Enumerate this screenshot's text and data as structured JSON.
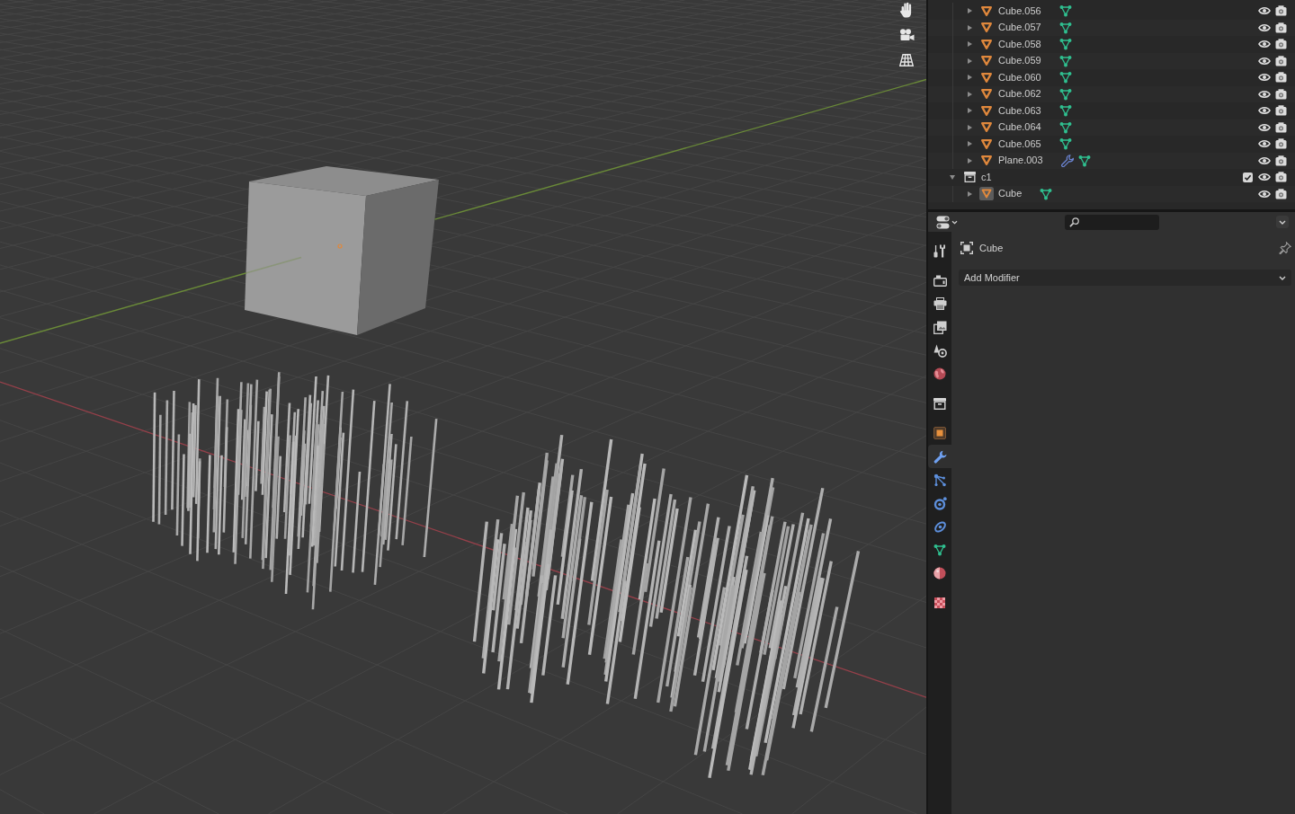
{
  "outliner": {
    "items": [
      {
        "children": [
          {
            "name": "Cube.056",
            "kind": "object",
            "expanded": false,
            "selected": false,
            "active": false,
            "modifier": false
          },
          {
            "name": "Cube.057",
            "kind": "object",
            "expanded": false,
            "selected": false,
            "active": false,
            "modifier": false
          },
          {
            "name": "Cube.058",
            "kind": "object",
            "expanded": false,
            "selected": false,
            "active": false,
            "modifier": false
          },
          {
            "name": "Cube.059",
            "kind": "object",
            "expanded": false,
            "selected": false,
            "active": false,
            "modifier": false
          },
          {
            "name": "Cube.060",
            "kind": "object",
            "expanded": false,
            "selected": false,
            "active": false,
            "modifier": false
          },
          {
            "name": "Cube.062",
            "kind": "object",
            "expanded": false,
            "selected": false,
            "active": false,
            "modifier": false
          },
          {
            "name": "Cube.063",
            "kind": "object",
            "expanded": false,
            "selected": false,
            "active": false,
            "modifier": false
          },
          {
            "name": "Cube.064",
            "kind": "object",
            "expanded": false,
            "selected": false,
            "active": false,
            "modifier": false
          },
          {
            "name": "Cube.065",
            "kind": "object",
            "expanded": false,
            "selected": false,
            "active": false,
            "modifier": false
          },
          {
            "name": "Plane.003",
            "kind": "object",
            "expanded": false,
            "selected": false,
            "active": false,
            "modifier": true
          }
        ]
      },
      {
        "name": "c1",
        "kind": "collection",
        "expanded": true,
        "selected": false,
        "checked": true,
        "children": [
          {
            "name": "Cube",
            "kind": "object",
            "expanded": false,
            "selected": false,
            "active": true,
            "modifier": false
          }
        ]
      }
    ]
  },
  "properties": {
    "tab_groups": [
      {
        "tabs": [
          {
            "kind": "tool",
            "selected": false
          }
        ]
      },
      {
        "tabs": [
          {
            "kind": "render",
            "selected": false
          },
          {
            "kind": "output",
            "selected": false
          },
          {
            "kind": "view_layer",
            "selected": false
          },
          {
            "kind": "scene",
            "selected": false
          },
          {
            "kind": "world",
            "selected": false
          }
        ]
      },
      {
        "tabs": [
          {
            "kind": "collection",
            "selected": false
          }
        ]
      },
      {
        "tabs": [
          {
            "kind": "object",
            "selected": false
          },
          {
            "kind": "modifiers",
            "selected": true
          },
          {
            "kind": "particles",
            "selected": false
          },
          {
            "kind": "physics",
            "selected": false
          },
          {
            "kind": "constraints",
            "selected": false
          },
          {
            "kind": "data",
            "selected": false
          },
          {
            "kind": "material",
            "selected": false
          }
        ]
      },
      {
        "tabs": [
          {
            "kind": "texture",
            "selected": false
          }
        ]
      }
    ],
    "object_name": "Cube",
    "add_modifier": {
      "label": "Add Modifier"
    }
  }
}
